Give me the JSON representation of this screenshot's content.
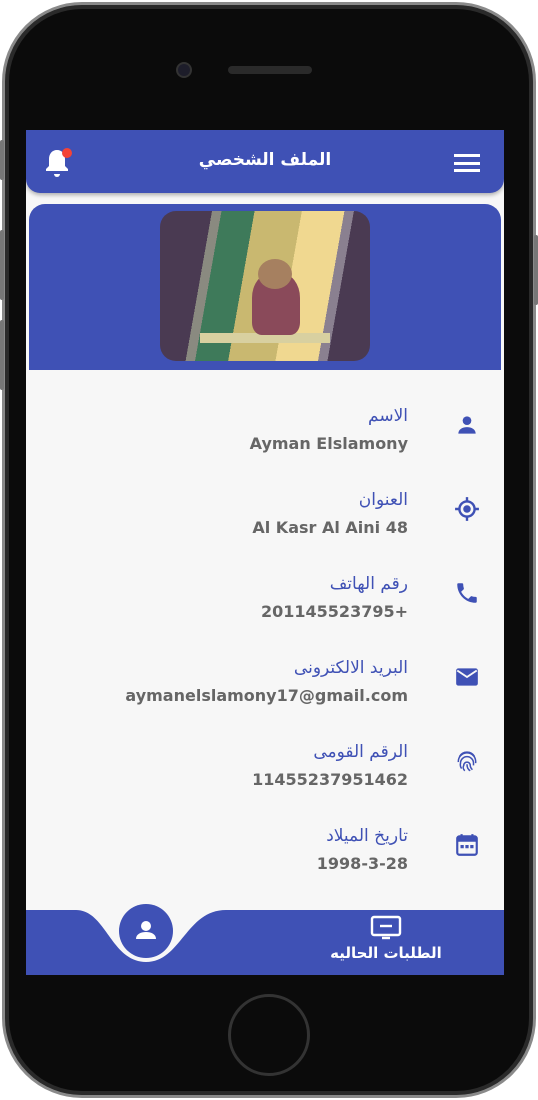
{
  "appbar": {
    "title": "الملف الشخصي",
    "menu_icon": "hamburger-icon",
    "notification_icon": "bell-icon",
    "notification_badge_color": "#f44336"
  },
  "theme": {
    "primary": "#3f51b5",
    "value_text": "#666666"
  },
  "profile": {
    "fields": [
      {
        "label": "الاسم",
        "value": "Ayman Elslamony",
        "icon": "person-icon"
      },
      {
        "label": "العنوان",
        "value": "Al Kasr Al Aini 48",
        "icon": "location-target-icon"
      },
      {
        "label": "رقم الهاتف",
        "value": "201145523795+",
        "icon": "phone-icon"
      },
      {
        "label": "البريد الالكترونى",
        "value": "aymanelslamony17@gmail.com",
        "icon": "email-icon"
      },
      {
        "label": "الرقم القومى",
        "value": "11455237951462",
        "icon": "fingerprint-icon"
      },
      {
        "label": "تاريخ الميلاد",
        "value": "1998-3-28",
        "icon": "calendar-icon"
      }
    ]
  },
  "bottom_nav": {
    "items": [
      {
        "label": "",
        "icon": "person-icon",
        "active": true
      },
      {
        "label": "الطلبات الحاليه",
        "icon": "monitor-icon"
      }
    ]
  }
}
